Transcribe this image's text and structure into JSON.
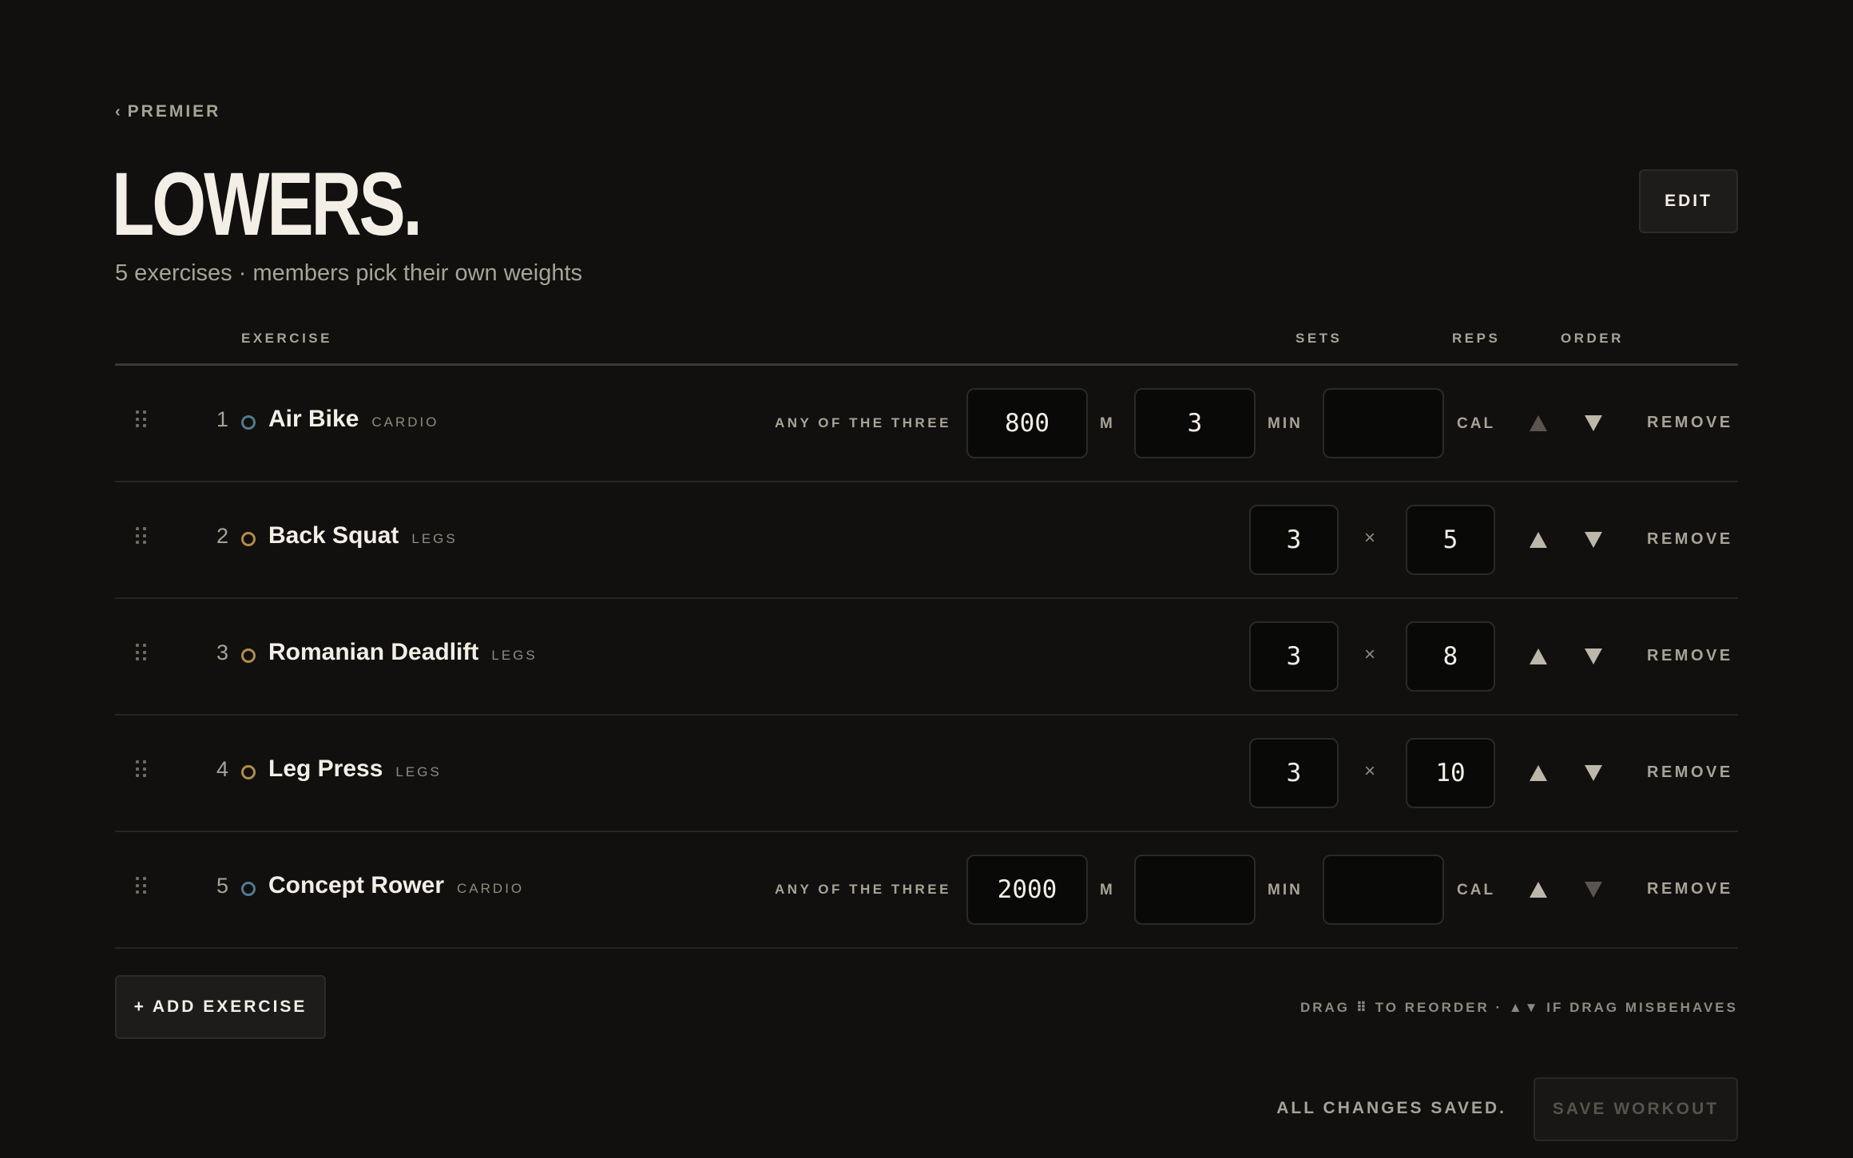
{
  "breadcrumb": {
    "chevron": "‹",
    "label": "PREMIER"
  },
  "header": {
    "title": "LOWERS.",
    "subtitle": "5 exercises · members pick their own weights",
    "edit_label": "EDIT"
  },
  "table": {
    "headers": {
      "exercise": "EXERCISE",
      "sets": "SETS",
      "reps": "REPS",
      "order": "ORDER"
    },
    "any_label": "ANY OF THE THREE",
    "units": {
      "m": "M",
      "min": "MIN",
      "cal": "CAL"
    },
    "times_symbol": "×",
    "remove_label": "REMOVE",
    "rows": [
      {
        "index": "1",
        "name": "Air Bike",
        "tag": "CARDIO",
        "kind": "cardio",
        "meters": "800",
        "minutes": "3",
        "calories": "",
        "up_disabled": true,
        "down_disabled": false
      },
      {
        "index": "2",
        "name": "Back Squat",
        "tag": "LEGS",
        "kind": "strength",
        "sets": "3",
        "reps": "5",
        "up_disabled": false,
        "down_disabled": false
      },
      {
        "index": "3",
        "name": "Romanian Deadlift",
        "tag": "LEGS",
        "kind": "strength",
        "sets": "3",
        "reps": "8",
        "up_disabled": false,
        "down_disabled": false
      },
      {
        "index": "4",
        "name": "Leg Press",
        "tag": "LEGS",
        "kind": "strength",
        "sets": "3",
        "reps": "10",
        "up_disabled": false,
        "down_disabled": false
      },
      {
        "index": "5",
        "name": "Concept Rower",
        "tag": "CARDIO",
        "kind": "cardio",
        "meters": "2000",
        "minutes": "",
        "calories": "",
        "up_disabled": false,
        "down_disabled": true
      }
    ]
  },
  "footer": {
    "add_label": "+ ADD EXERCISE",
    "hint": "DRAG ⠿ TO REORDER · ▲▼ IF DRAG MISBEHAVES",
    "status": "ALL CHANGES SAVED.",
    "save_label": "SAVE WORKOUT"
  },
  "colors": {
    "background": "#11100f",
    "strength_dot": "#b08d4a",
    "cardio_dot": "#4f7b8f"
  }
}
